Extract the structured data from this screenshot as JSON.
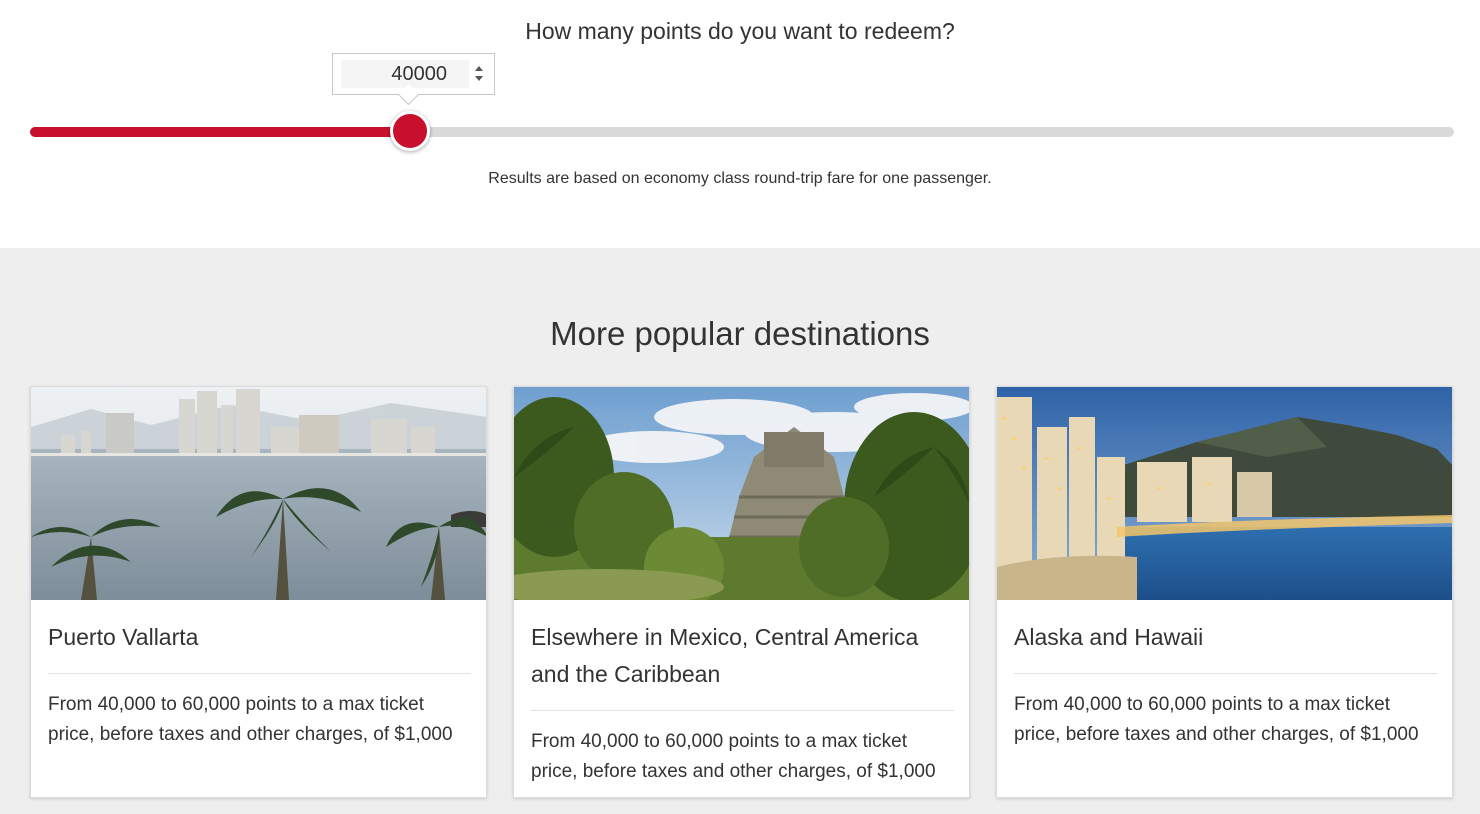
{
  "slider": {
    "question": "How many points do you want to redeem?",
    "value": "40000",
    "min": 0,
    "max": 150000,
    "note": "Results are based on economy class round-trip fare for one passenger.",
    "accent_color": "#c8102e",
    "track_color": "#d9d9d9"
  },
  "destinations": {
    "title": "More popular destinations",
    "cards": [
      {
        "name": "Puerto Vallarta",
        "description": "From 40,000 to 60,000 points to a max ticket price, before taxes and other charges, of $1,000"
      },
      {
        "name": "Elsewhere in Mexico, Central America and the Caribbean",
        "description": "From 40,000 to 60,000 points to a max ticket price, before taxes and other charges, of $1,000"
      },
      {
        "name": "Alaska and Hawaii",
        "description": "From 40,000 to 60,000 points to a max ticket price, before taxes and other charges, of $1,000"
      }
    ]
  }
}
